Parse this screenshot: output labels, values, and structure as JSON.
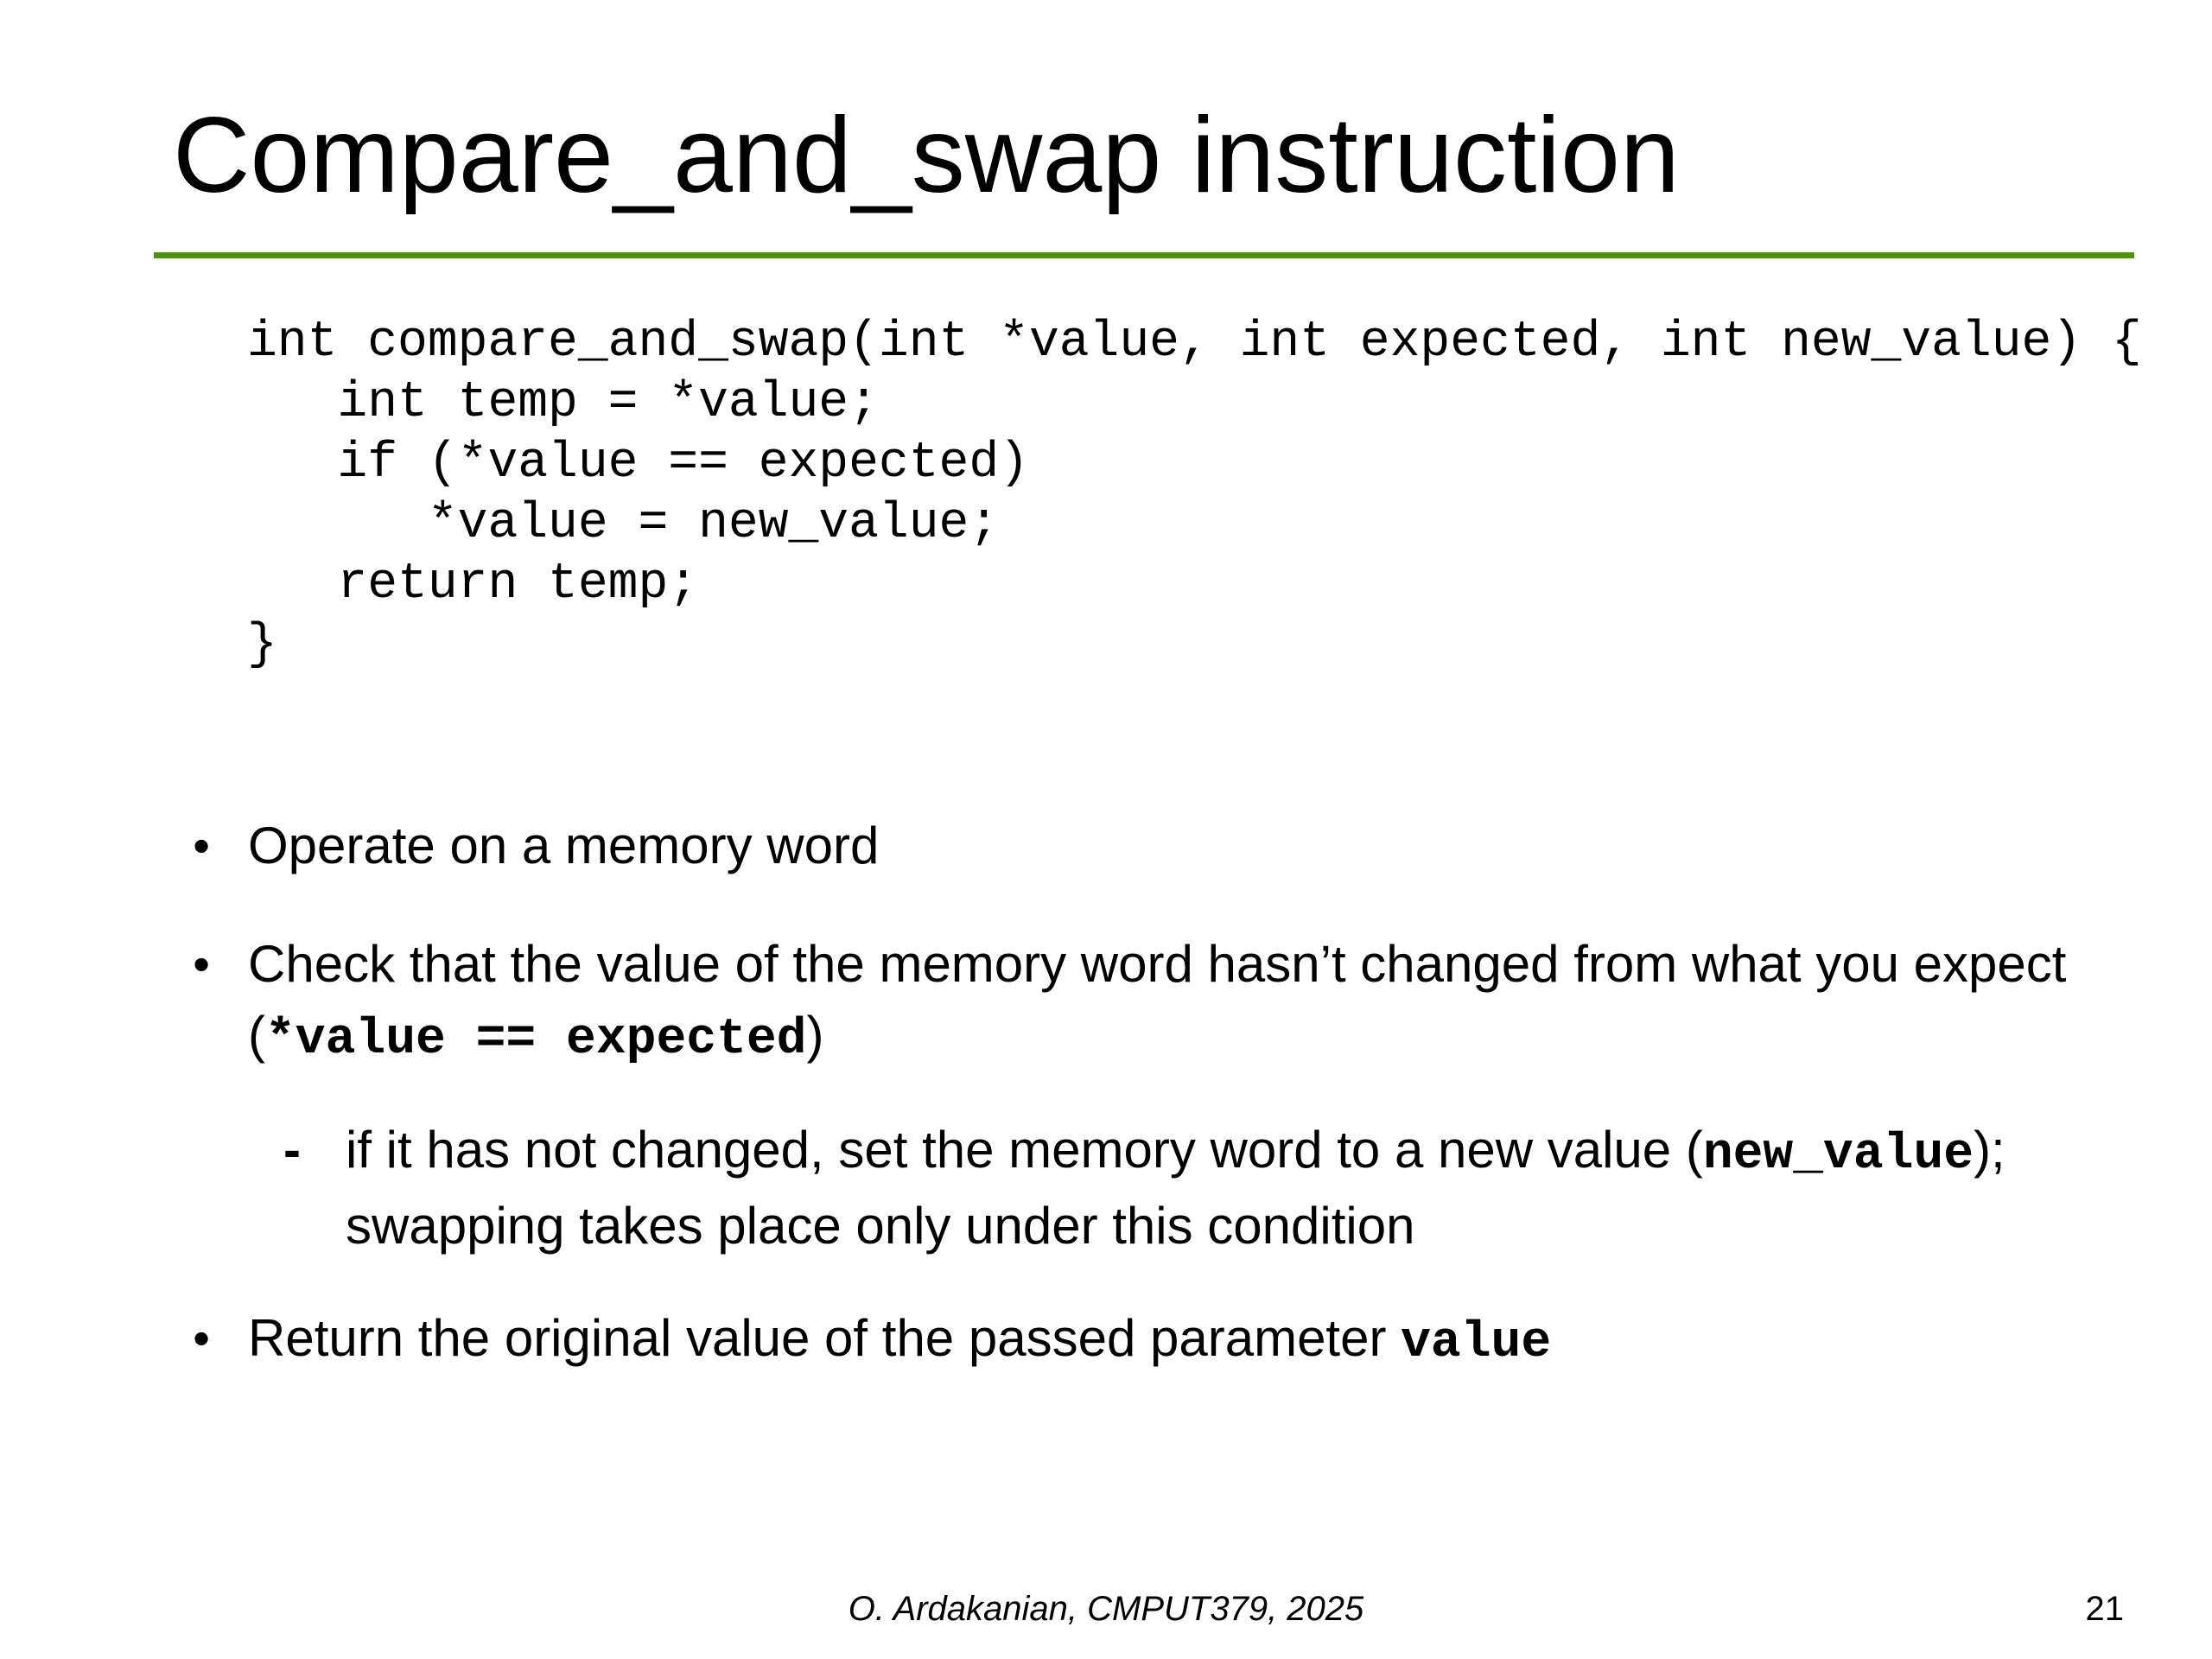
{
  "slide": {
    "title": "Compare_and_swap instruction",
    "accent_color": "#4e8f14",
    "code": [
      "int compare_and_swap(int *value, int expected, int new_value) {",
      "   int temp = *value;",
      "   if (*value == expected)",
      "      *value = new_value;",
      "   return temp;",
      "}"
    ],
    "bullets": {
      "b1": {
        "marker": "•",
        "text": "Operate on a memory word"
      },
      "b2": {
        "marker": "•",
        "text_before": "Check that the value of the memory word hasn’t changed from what you expect (",
        "code": "*value == expected",
        "text_after": ")"
      },
      "b2_sub": {
        "marker": "-",
        "text_before": "if it has not changed, set the memory word to a new value (",
        "code": "new_value",
        "text_after": "); swapping takes place only under this condition"
      },
      "b3": {
        "marker": "•",
        "text_before": "Return the original value of the passed parameter ",
        "code": "value"
      }
    },
    "footer": "O. Ardakanian, CMPUT379, 2025",
    "page_number": "21"
  }
}
